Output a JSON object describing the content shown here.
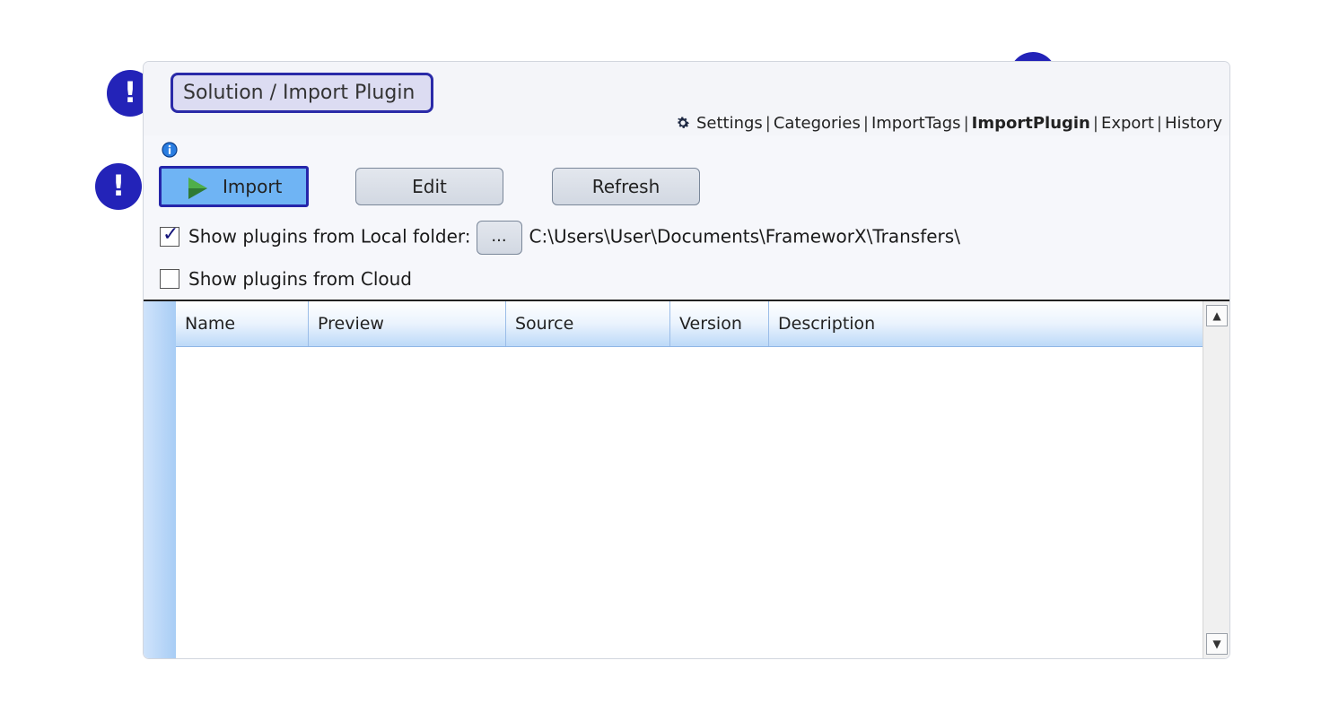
{
  "header": {
    "title": "Solution / Import Plugin"
  },
  "nav": {
    "settings": "Settings",
    "categories": "Categories",
    "import_tags": "ImportTags",
    "import_plugin": "ImportPlugin",
    "export": "Export",
    "history": "History",
    "separator": "|"
  },
  "toolbar": {
    "import_label": "Import",
    "edit_label": "Edit",
    "refresh_label": "Refresh"
  },
  "options": {
    "local_folder": {
      "label": "Show plugins from Local folder:",
      "checked": true,
      "browse_label": "...",
      "path": "C:\\Users\\User\\Documents\\FrameworX\\Transfers\\"
    },
    "cloud": {
      "label": "Show plugins from Cloud",
      "checked": false
    }
  },
  "grid": {
    "columns": [
      "Name",
      "Preview",
      "Source",
      "Version",
      "Description"
    ],
    "rows": []
  },
  "annotations": {
    "marker_symbol": "!"
  },
  "colors": {
    "accent": "#2323b8",
    "import_button": "#6fb4f4",
    "title_highlight": "#dcdcf2"
  }
}
